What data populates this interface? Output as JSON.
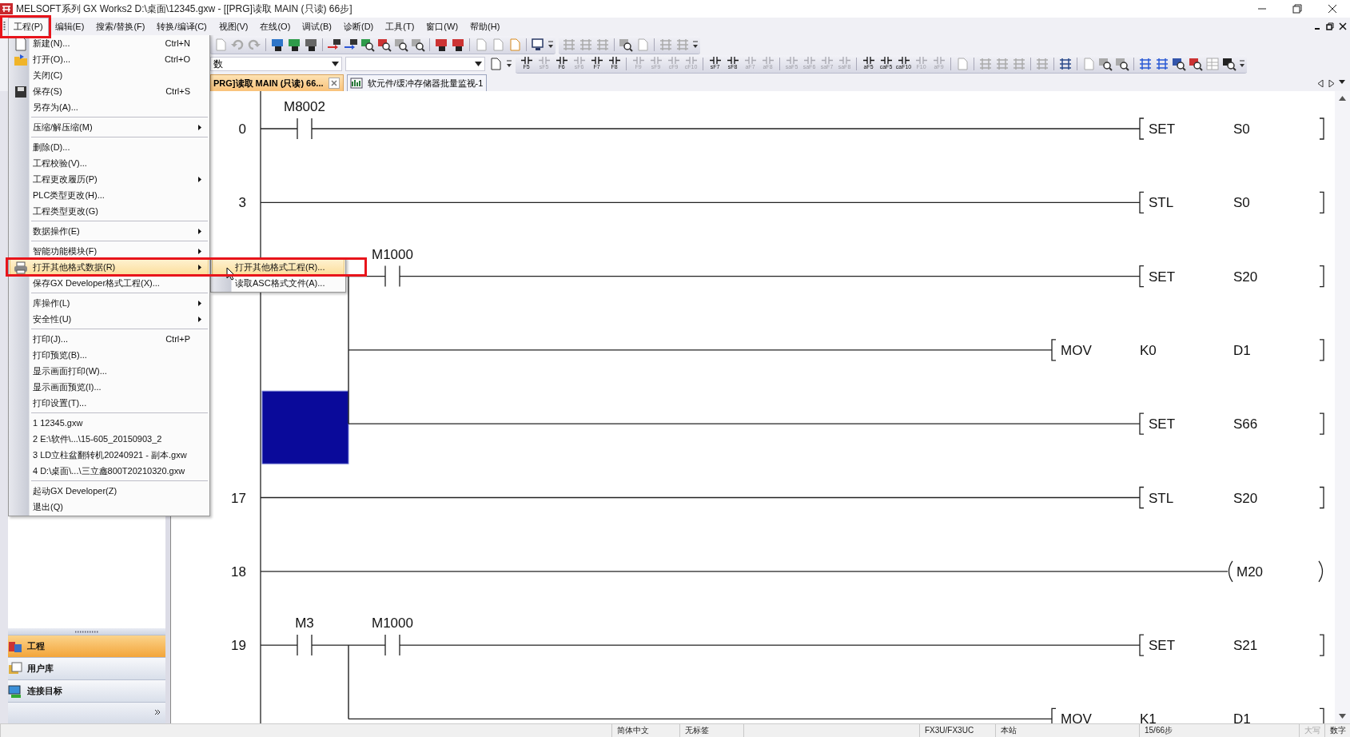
{
  "window": {
    "title": "MELSOFT系列 GX Works2 D:\\桌面\\12345.gxw - [[PRG]读取 MAIN (只读) 66步]"
  },
  "menu_bar": [
    {
      "label": "工程(P)",
      "selected": true,
      "highlighted": true
    },
    {
      "label": "编辑(E)",
      "selected": false,
      "highlighted": false
    },
    {
      "label": "搜索/替换(F)",
      "selected": false,
      "highlighted": false
    },
    {
      "label": "转换/编译(C)",
      "selected": false,
      "highlighted": false
    },
    {
      "label": "视图(V)",
      "selected": false,
      "highlighted": false
    },
    {
      "label": "在线(O)",
      "selected": false,
      "highlighted": false
    },
    {
      "label": "调试(B)",
      "selected": false,
      "highlighted": false
    },
    {
      "label": "诊断(D)",
      "selected": false,
      "highlighted": false
    },
    {
      "label": "工具(T)",
      "selected": false,
      "highlighted": false
    },
    {
      "label": "窗口(W)",
      "selected": false,
      "highlighted": false
    },
    {
      "label": "帮助(H)",
      "selected": false,
      "highlighted": false
    }
  ],
  "toolbar": {
    "combo": {
      "value": "数"
    }
  },
  "ladder_tools": [
    {
      "key": "F5",
      "disabled": false
    },
    {
      "key": "sF5",
      "disabled": true
    },
    {
      "key": "F6",
      "disabled": false
    },
    {
      "key": "sF6",
      "disabled": true
    },
    {
      "key": "F7",
      "disabled": false
    },
    {
      "key": "F8",
      "disabled": false
    },
    {
      "key": "F9",
      "disabled": true
    },
    {
      "key": "sF9",
      "disabled": true
    },
    {
      "key": "cF9",
      "disabled": true
    },
    {
      "key": "cF10",
      "disabled": true
    },
    {
      "key": "sF7",
      "disabled": false
    },
    {
      "key": "sF8",
      "disabled": false
    },
    {
      "key": "aF7",
      "disabled": true
    },
    {
      "key": "aF8",
      "disabled": true
    },
    {
      "key": "saF5",
      "disabled": true
    },
    {
      "key": "saF6",
      "disabled": true
    },
    {
      "key": "saF7",
      "disabled": true
    },
    {
      "key": "saF8",
      "disabled": true
    },
    {
      "key": "aF5",
      "disabled": false
    },
    {
      "key": "caF5",
      "disabled": false
    },
    {
      "key": "caF10",
      "disabled": false
    },
    {
      "key": "F10",
      "disabled": true
    },
    {
      "key": "aF9",
      "disabled": true
    }
  ],
  "tabs": [
    {
      "label": "PRG]读取 MAIN (只读) 66...",
      "selected": true,
      "closable": true
    },
    {
      "label": "软元件/缓冲存储器批量监视-1",
      "selected": false,
      "closable": false
    }
  ],
  "file_menu": {
    "items": [
      {
        "kind": "item",
        "label": "新建(N)...",
        "shortcut": "Ctrl+N",
        "submenu": false,
        "selected": false,
        "highlighted": false
      },
      {
        "kind": "item",
        "label": "打开(O)...",
        "shortcut": "Ctrl+O",
        "submenu": false,
        "selected": false,
        "highlighted": false
      },
      {
        "kind": "item",
        "label": "关闭(C)",
        "submenu": false,
        "selected": false,
        "highlighted": false
      },
      {
        "kind": "item",
        "label": "保存(S)",
        "shortcut": "Ctrl+S",
        "submenu": false,
        "selected": false,
        "highlighted": false
      },
      {
        "kind": "item",
        "label": "另存为(A)...",
        "submenu": false,
        "selected": false,
        "highlighted": false
      },
      {
        "kind": "separator"
      },
      {
        "kind": "item",
        "label": "压缩/解压缩(M)",
        "submenu": true,
        "selected": false,
        "highlighted": false
      },
      {
        "kind": "separator"
      },
      {
        "kind": "item",
        "label": "删除(D)...",
        "submenu": false,
        "selected": false,
        "highlighted": false
      },
      {
        "kind": "item",
        "label": "工程校验(V)...",
        "submenu": false,
        "selected": false,
        "highlighted": false
      },
      {
        "kind": "item",
        "label": "工程更改履历(P)",
        "submenu": true,
        "selected": false,
        "highlighted": false
      },
      {
        "kind": "item",
        "label": "PLC类型更改(H)...",
        "submenu": false,
        "selected": false,
        "highlighted": false
      },
      {
        "kind": "item",
        "label": "工程类型更改(G)",
        "submenu": false,
        "selected": false,
        "highlighted": false
      },
      {
        "kind": "separator"
      },
      {
        "kind": "item",
        "label": "数据操作(E)",
        "submenu": true,
        "selected": false,
        "highlighted": false
      },
      {
        "kind": "separator"
      },
      {
        "kind": "item",
        "label": "智能功能模块(F)",
        "submenu": true,
        "selected": false,
        "highlighted": false
      },
      {
        "kind": "item",
        "label": "打开其他格式数据(R)",
        "submenu": true,
        "selected": true,
        "highlighted": true
      },
      {
        "kind": "item",
        "label": "保存GX Developer格式工程(X)...",
        "submenu": false,
        "selected": false,
        "highlighted": false
      },
      {
        "kind": "separator"
      },
      {
        "kind": "item",
        "label": "库操作(L)",
        "submenu": true,
        "selected": false,
        "highlighted": false
      },
      {
        "kind": "item",
        "label": "安全性(U)",
        "submenu": true,
        "selected": false,
        "highlighted": false
      },
      {
        "kind": "separator"
      },
      {
        "kind": "item",
        "label": "打印(J)...",
        "shortcut": "Ctrl+P",
        "submenu": false,
        "selected": false,
        "highlighted": false
      },
      {
        "kind": "item",
        "label": "打印预览(B)...",
        "submenu": false,
        "selected": false,
        "highlighted": false
      },
      {
        "kind": "item",
        "label": "显示画面打印(W)...",
        "submenu": false,
        "selected": false,
        "highlighted": false
      },
      {
        "kind": "item",
        "label": "显示画面预览(I)...",
        "submenu": false,
        "selected": false,
        "highlighted": false
      },
      {
        "kind": "item",
        "label": "打印设置(T)...",
        "submenu": false,
        "selected": false,
        "highlighted": false
      },
      {
        "kind": "separator"
      },
      {
        "kind": "item",
        "label": "1 12345.gxw",
        "submenu": false,
        "selected": false,
        "highlighted": false
      },
      {
        "kind": "item",
        "label": "2 E:\\软件\\...\\15-605_20150903_2",
        "submenu": false,
        "selected": false,
        "highlighted": false
      },
      {
        "kind": "item",
        "label": "3 LD立柱盆翻转机20240921 - 副本.gxw",
        "submenu": false,
        "selected": false,
        "highlighted": false
      },
      {
        "kind": "item",
        "label": "4 D:\\桌面\\...\\三立鑫800T20210320.gxw",
        "submenu": false,
        "selected": false,
        "highlighted": false
      },
      {
        "kind": "separator"
      },
      {
        "kind": "item",
        "label": "起动GX Developer(Z)",
        "submenu": false,
        "selected": false,
        "highlighted": false
      },
      {
        "kind": "item",
        "label": "退出(Q)",
        "submenu": false,
        "selected": false,
        "highlighted": false
      }
    ]
  },
  "submenu": {
    "items": [
      {
        "label": "打开其他格式工程(R)...",
        "selected": true
      },
      {
        "label": "读取ASC格式文件(A)...",
        "selected": false
      }
    ]
  },
  "navigation": [
    {
      "label": "工程",
      "selected": true
    },
    {
      "label": "用户库",
      "selected": false
    },
    {
      "label": "连接目标",
      "selected": false
    }
  ],
  "ladder": {
    "rungs": [
      {
        "step": "0",
        "branch": false,
        "cursor": false,
        "contacts": [
          {
            "kind": "contact",
            "device": "M8002"
          }
        ],
        "kind": "instruction",
        "instruction": "SET",
        "operands": [
          "S0"
        ]
      },
      {
        "step": "3",
        "branch": false,
        "cursor": false,
        "kind": "instruction",
        "instruction": "STL",
        "operands": [
          "S0"
        ]
      },
      {
        "branch": false,
        "cursor": false,
        "contacts": [
          {
            "kind": "covered"
          },
          {
            "kind": "contact",
            "device": "M1000"
          }
        ],
        "kind": "instruction",
        "instruction": "SET",
        "operands": [
          "S20"
        ]
      },
      {
        "branch": true,
        "cursor": false,
        "kind": "instruction",
        "instruction": "MOV",
        "operands": [
          "K0",
          "D1"
        ]
      },
      {
        "branch": true,
        "cursor": true,
        "kind": "instruction",
        "instruction": "SET",
        "operands": [
          "S66"
        ]
      },
      {
        "step": "17",
        "branch": false,
        "cursor": false,
        "kind": "instruction",
        "instruction": "STL",
        "operands": [
          "S20"
        ]
      },
      {
        "step": "18",
        "branch": false,
        "cursor": false,
        "kind": "coil",
        "operands": [
          "M20"
        ]
      },
      {
        "step": "19",
        "branch": false,
        "cursor": false,
        "contacts": [
          {
            "kind": "contact",
            "device": "M3"
          },
          {
            "kind": "contact",
            "device": "M1000"
          }
        ],
        "kind": "instruction",
        "instruction": "SET",
        "operands": [
          "S21"
        ]
      },
      {
        "branch": true,
        "cursor": false,
        "kind": "instruction",
        "instruction": "MOV",
        "operands": [
          "K1",
          "D1"
        ]
      }
    ]
  },
  "status_bar": [
    {
      "text": "简体中文",
      "disabled": false
    },
    {
      "text": "无标签",
      "disabled": false
    },
    {
      "text": "FX3U/FX3UC",
      "disabled": false
    },
    {
      "text": "本站",
      "disabled": false
    },
    {
      "text": "15/66步",
      "disabled": false
    },
    {
      "text": "大写",
      "disabled": true
    },
    {
      "text": "数字",
      "disabled": false
    }
  ]
}
